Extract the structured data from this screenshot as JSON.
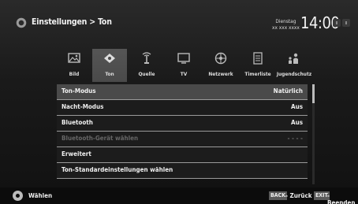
{
  "header": {
    "breadcrumb": "Einstellungen > Ton",
    "date_line1": "Dienstag",
    "date_line2": "xx xxx xxxx",
    "time": "14:00"
  },
  "categories": [
    {
      "label": "Bild",
      "icon": "picture-icon"
    },
    {
      "label": "Ton",
      "icon": "sound-icon",
      "selected": true
    },
    {
      "label": "Quelle",
      "icon": "source-icon"
    },
    {
      "label": "TV",
      "icon": "tv-icon"
    },
    {
      "label": "Netzwerk",
      "icon": "network-icon"
    },
    {
      "label": "Timerliste",
      "icon": "timer-list-icon"
    },
    {
      "label": "Jugendschutz",
      "icon": "parental-control-icon"
    }
  ],
  "settings": [
    {
      "label": "Ton-Modus",
      "value": "Natürlich",
      "focused": true
    },
    {
      "label": "Nacht-Modus",
      "value": "Aus"
    },
    {
      "label": "Bluetooth",
      "value": "Aus"
    },
    {
      "label": "Bluetooth-Gerät wählen",
      "value": "- - - -",
      "disabled": true
    },
    {
      "label": "Erweitert",
      "value": ""
    },
    {
      "label": "Ton-Standardeinstellungen wählen",
      "value": ""
    }
  ],
  "footer": {
    "select_label": "Wählen",
    "back_key": "BACK",
    "back_label": "- Zurück",
    "exit_key": "EXIT",
    "exit_label": "- Beenden"
  }
}
